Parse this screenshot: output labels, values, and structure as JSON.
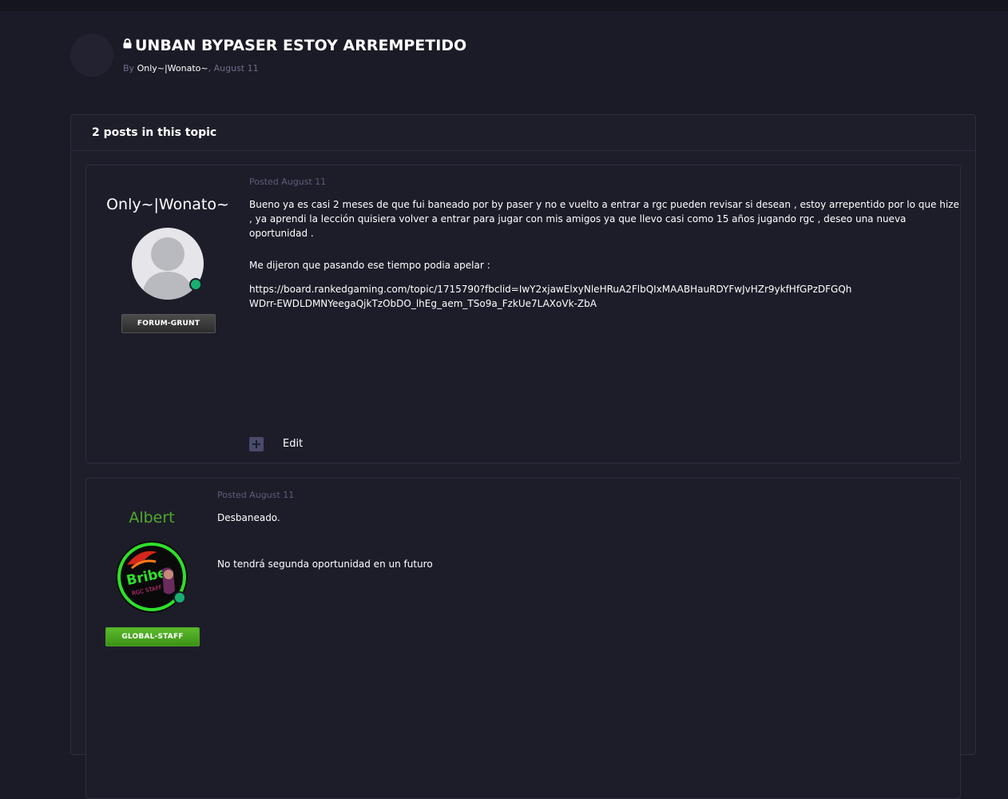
{
  "topic": {
    "title": "UNBAN BYPASER ESTOY ARREMPETIDO",
    "by_label": "By",
    "author": "Only~|Wonato~",
    "date_suffix": ", August 11"
  },
  "panel": {
    "post_count_label": "2 posts in this topic"
  },
  "posts": [
    {
      "username": "Only~|Wonato~",
      "rank": "FORUM-GRUNT",
      "posted": "Posted August 11",
      "paragraphs": [
        "Bueno ya es casi  2 meses de que fui baneado por by paser y no e vuelto a entrar a rgc pueden revisar si desean  , estoy arrepentido por lo que hize , ya aprendi la lección quisiera volver a entrar para jugar con mis amigos ya que llevo casi como 15 años jugando rgc , deseo una nueva oportunidad .",
        "Me dijeron que pasando ese tiempo podia apelar :",
        "https://board.rankedgaming.com/topic/1715790?fbclid=IwY2xjawElxyNleHRuA2FlbQIxMAABHauRDYFwJvHZr9ykfHfGPzDFGQhWDrr-EWDLDMNYeegaQjkTzObDO_lhEg_aem_TSo9a_FzkUe7LAXoVk-ZbA"
      ],
      "edit_label": "Edit"
    },
    {
      "username": "Albert",
      "rank": "GLOBAL-STAFF",
      "posted": "Posted August 11",
      "paragraphs": [
        "Desbaneado.",
        "No tendrá segunda oportunidad en un futuro"
      ]
    }
  ],
  "colors": {
    "background": "#1b1b27",
    "staff_name": "#4faa2a",
    "online": "#17b070",
    "muted": "#5d5d78"
  }
}
